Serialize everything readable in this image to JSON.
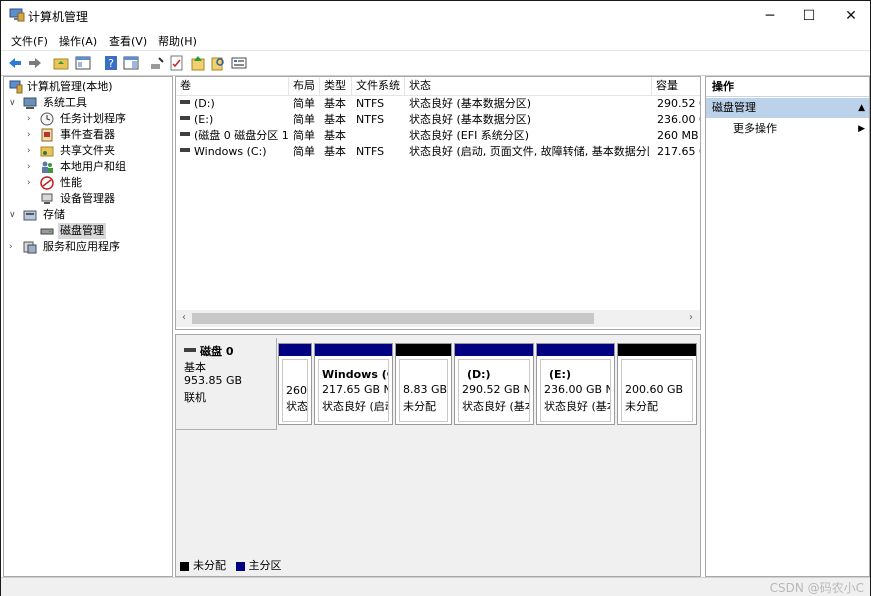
{
  "window": {
    "title": "计算机管理",
    "controls": {
      "minimize": "─",
      "maximize": "☐",
      "close": "✕"
    }
  },
  "menu": [
    "文件(F)",
    "操作(A)",
    "查看(V)",
    "帮助(H)"
  ],
  "toolbar": [
    "back-icon",
    "forward-icon",
    "up-folder-icon",
    "show-hide-tree-icon",
    "help-icon",
    "panel-icon",
    "connect-icon",
    "checklist-icon",
    "up-arrow-icon",
    "search-icon",
    "properties-icon"
  ],
  "tree": {
    "items": [
      {
        "label": "计算机管理(本地)",
        "icon": "computer-management-icon",
        "expander": ""
      },
      {
        "label": "系统工具",
        "icon": "tools-icon",
        "expander": "∨"
      },
      {
        "label": "任务计划程序",
        "icon": "clock-icon",
        "expander": "›"
      },
      {
        "label": "事件查看器",
        "icon": "event-viewer-icon",
        "expander": "›"
      },
      {
        "label": "共享文件夹",
        "icon": "shared-folder-icon",
        "expander": "›"
      },
      {
        "label": "本地用户和组",
        "icon": "users-icon",
        "expander": "›"
      },
      {
        "label": "性能",
        "icon": "performance-icon",
        "expander": "›"
      },
      {
        "label": "设备管理器",
        "icon": "device-manager-icon",
        "expander": ""
      },
      {
        "label": "存储",
        "icon": "storage-icon",
        "expander": "∨"
      },
      {
        "label": "磁盘管理",
        "icon": "disk-icon",
        "expander": ""
      },
      {
        "label": "服务和应用程序",
        "icon": "services-icon",
        "expander": "›"
      }
    ]
  },
  "volumes": {
    "headers": [
      "卷",
      "布局",
      "类型",
      "文件系统",
      "状态",
      "容量"
    ],
    "rows": [
      {
        "name": "(D:)",
        "layout": "简单",
        "type": "基本",
        "fs": "NTFS",
        "status": "状态良好 (基本数据分区)",
        "capacity": "290.52 G"
      },
      {
        "name": "(E:)",
        "layout": "简单",
        "type": "基本",
        "fs": "NTFS",
        "status": "状态良好 (基本数据分区)",
        "capacity": "236.00 G"
      },
      {
        "name": "(磁盘 0 磁盘分区 1)",
        "layout": "简单",
        "type": "基本",
        "fs": "",
        "status": "状态良好 (EFI 系统分区)",
        "capacity": "260 MB"
      },
      {
        "name": "Windows (C:)",
        "layout": "简单",
        "type": "基本",
        "fs": "NTFS",
        "status": "状态良好 (启动, 页面文件, 故障转储, 基本数据分区)",
        "capacity": "217.65 G"
      }
    ],
    "scroll_left": "‹",
    "scroll_right": "›"
  },
  "disk": {
    "name": "磁盘 0",
    "type": "基本",
    "size": "953.85 GB",
    "state": "联机",
    "partitions": [
      {
        "title": "",
        "size": "260",
        "status": "状态",
        "kind": "primary"
      },
      {
        "title": "Windows (C",
        "size": "217.65 GB NT",
        "status": "状态良好 (启动",
        "kind": "primary"
      },
      {
        "title": "",
        "size": "8.83 GB",
        "status": "未分配",
        "kind": "unallocated"
      },
      {
        "title": "(D:)",
        "size": "290.52 GB NT",
        "status": "状态良好 (基本",
        "kind": "primary"
      },
      {
        "title": "(E:)",
        "size": "236.00 GB NT",
        "status": "状态良好 (基本",
        "kind": "primary"
      },
      {
        "title": "",
        "size": "200.60 GB",
        "status": "未分配",
        "kind": "unallocated"
      }
    ]
  },
  "legend": [
    {
      "label": "未分配",
      "color": "#000000"
    },
    {
      "label": "主分区",
      "color": "#000080"
    }
  ],
  "actions": {
    "header": "操作",
    "section": "磁盘管理",
    "section_arrow": "▲",
    "more": "更多操作",
    "more_arrow": "▶"
  },
  "watermark": "CSDN @码农小C",
  "colors": {
    "primary_band": "#000080",
    "unallocated_band": "#000000",
    "action_section_bg": "#bcd1ea"
  }
}
